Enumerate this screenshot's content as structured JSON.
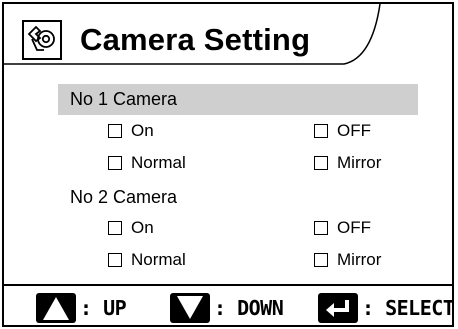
{
  "header": {
    "title": "Camera Setting",
    "icon": "camera-setting-icon"
  },
  "cameras": [
    {
      "label": "No 1 Camera",
      "selected": true,
      "options": [
        {
          "label": "On",
          "checked": false
        },
        {
          "label": "OFF",
          "checked": false
        },
        {
          "label": "Normal",
          "checked": false
        },
        {
          "label": "Mirror",
          "checked": false
        }
      ]
    },
    {
      "label": "No 2 Camera",
      "selected": false,
      "options": [
        {
          "label": "On",
          "checked": false
        },
        {
          "label": "OFF",
          "checked": false
        },
        {
          "label": "Normal",
          "checked": false
        },
        {
          "label": "Mirror",
          "checked": false
        }
      ]
    }
  ],
  "footer": {
    "up": {
      "icon": "up-arrow-key-icon",
      "label": ": UP"
    },
    "down": {
      "icon": "down-arrow-key-icon",
      "label": ": DOWN"
    },
    "select": {
      "icon": "enter-key-icon",
      "label": ": SELECT"
    }
  },
  "colors": {
    "highlight": "#cfcfcf",
    "ink": "#000000",
    "background": "#ffffff"
  }
}
